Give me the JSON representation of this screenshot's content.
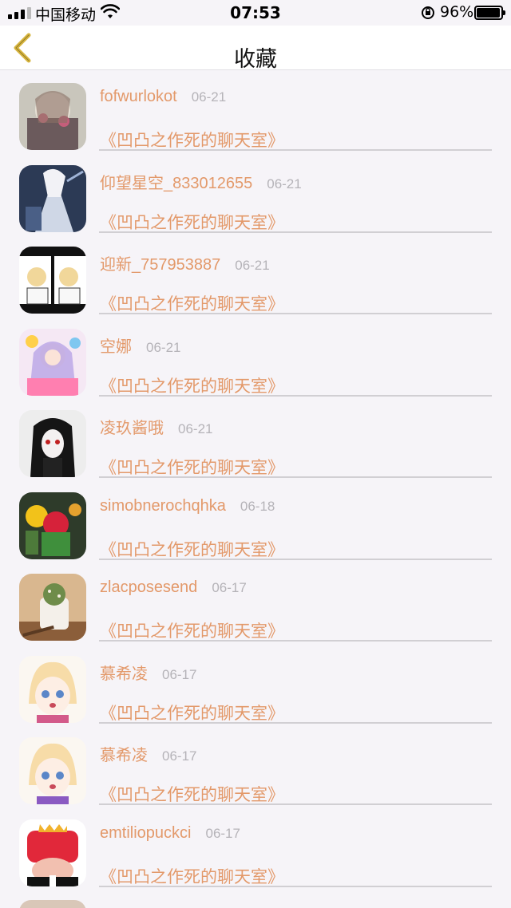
{
  "status_bar": {
    "carrier": "中国移动",
    "time": "07:53",
    "battery_percent": "96%",
    "battery_level": 0.96
  },
  "nav": {
    "title": "收藏",
    "back_icon": "chevron-left-icon",
    "accent_color": "#d8b640"
  },
  "colors": {
    "accent": "#e3996a",
    "date": "#b5b3b8",
    "background": "#f6f4f8"
  },
  "favorites": [
    {
      "name": "fofwurlokot",
      "date": "06-21",
      "title": "《凹凸之作死的聊天室》"
    },
    {
      "name": "仰望星空_833012655",
      "date": "06-21",
      "title": "《凹凸之作死的聊天室》"
    },
    {
      "name": "迎新_757953887",
      "date": "06-21",
      "title": "《凹凸之作死的聊天室》"
    },
    {
      "name": "空娜",
      "date": "06-21",
      "title": "《凹凸之作死的聊天室》"
    },
    {
      "name": "凌玖酱哦",
      "date": "06-21",
      "title": "《凹凸之作死的聊天室》"
    },
    {
      "name": "simobnerochqhka",
      "date": "06-18",
      "title": "《凹凸之作死的聊天室》"
    },
    {
      "name": "zlacposesend",
      "date": "06-17",
      "title": "《凹凸之作死的聊天室》"
    },
    {
      "name": "慕希凌",
      "date": "06-17",
      "title": "《凹凸之作死的聊天室》"
    },
    {
      "name": "慕希凌",
      "date": "06-17",
      "title": "《凹凸之作死的聊天室》"
    },
    {
      "name": "emtiliopuckci",
      "date": "06-17",
      "title": "《凹凸之作死的聊天室》"
    }
  ]
}
